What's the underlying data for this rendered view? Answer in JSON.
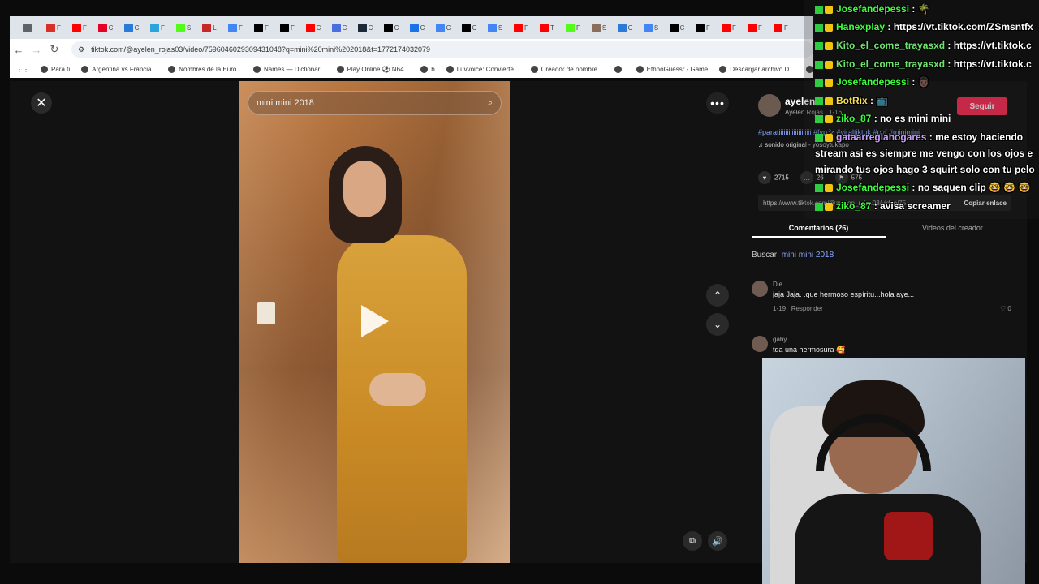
{
  "browser": {
    "tabs": [
      {
        "icon": "down-chevron-icon",
        "color": "#5f6368",
        "ch": ""
      },
      {
        "icon": "gmail-icon",
        "color": "#d93025",
        "ch": "F"
      },
      {
        "icon": "youtube-icon",
        "color": "#ff0000",
        "ch": "F"
      },
      {
        "icon": "pinterest-icon",
        "color": "#e60023",
        "ch": "C"
      },
      {
        "icon": "gif-icon",
        "color": "#2a7bd8",
        "ch": "C"
      },
      {
        "icon": "telegram-icon",
        "color": "#2aa3df",
        "ch": "F"
      },
      {
        "icon": "kick-icon",
        "color": "#53fc18",
        "ch": "S"
      },
      {
        "icon": "bookmark-red-icon",
        "color": "#c62828",
        "ch": "L"
      },
      {
        "icon": "google-icon",
        "color": "#4285f4",
        "ch": "F"
      },
      {
        "icon": "tiktok-icon",
        "color": "#000000",
        "ch": "F"
      },
      {
        "icon": "tiktok-icon",
        "color": "#000000",
        "ch": "F"
      },
      {
        "icon": "youtube-icon",
        "color": "#ff0000",
        "ch": "C"
      },
      {
        "icon": "docs-icon",
        "color": "#4a6ee0",
        "ch": "C"
      },
      {
        "icon": "steam-icon",
        "color": "#1b2838",
        "ch": "C"
      },
      {
        "icon": "tiktok-icon",
        "color": "#000000",
        "ch": "C"
      },
      {
        "icon": "download-icon",
        "color": "#1a73e8",
        "ch": "C"
      },
      {
        "icon": "google-icon",
        "color": "#4285f4",
        "ch": "C"
      },
      {
        "icon": "tiktok-icon",
        "color": "#000000",
        "ch": "C"
      },
      {
        "icon": "google-icon",
        "color": "#4285f4",
        "ch": "S"
      },
      {
        "icon": "youtube-icon",
        "color": "#ff0000",
        "ch": "F"
      },
      {
        "icon": "youtube-icon",
        "color": "#ff0000",
        "ch": "T"
      },
      {
        "icon": "kick-icon",
        "color": "#53fc18",
        "ch": "F"
      },
      {
        "icon": "image-icon",
        "color": "#8a6d5a",
        "ch": "S"
      },
      {
        "icon": "gif-icon",
        "color": "#2a7bd8",
        "ch": "C"
      },
      {
        "icon": "google-icon",
        "color": "#4285f4",
        "ch": "S"
      },
      {
        "icon": "tiktok-icon",
        "color": "#000000",
        "ch": "C"
      },
      {
        "icon": "tiktok-icon",
        "color": "#000000",
        "ch": "F"
      },
      {
        "icon": "youtube-icon",
        "color": "#ff0000",
        "ch": "F"
      },
      {
        "icon": "youtube-icon",
        "color": "#ff0000",
        "ch": "F"
      },
      {
        "icon": "youtube-icon",
        "color": "#ff0000",
        "ch": "F"
      }
    ],
    "url": "tiktok.com/@ayelen_rojas03/video/7596046029309431048?q=mini%20mini%202018&t=1772174032079",
    "bookmarks": [
      "Para ti",
      "Argentina vs Francia...",
      "Nombres de la Euro...",
      "Names — Dictionar...",
      "Play Online ⚽ N64...",
      "b",
      "Luvvoice: Convierte...",
      "Creador de nombre...",
      "",
      "EthnoGuessr - Game",
      "Descargar archivo D...",
      "(FREE FOR PROFIT)..."
    ]
  },
  "video": {
    "search_text": "mini mini 2018",
    "close_glyph": "✕",
    "more_glyph": "•••",
    "up_glyph": "⌃",
    "down_glyph": "⌄",
    "volume_glyph": "🔊",
    "pip_glyph": "⧉"
  },
  "panel": {
    "username": "ayelen",
    "subtitle": "Ayelen Rojas · 1-16",
    "follow_label": "Seguir",
    "hashtags": "#paratiiiiiiiiiiiiiiiiiiii #fypシ #viraltiktok #pyf #minimini",
    "music": "♫  sonido original - yosoytukapo",
    "stats": {
      "likes": "2715",
      "comments": "26",
      "saves": "575"
    },
    "link_text": "https://www.tiktok.com/@ayelen_rojas03/video/75...",
    "copy_link_label": "Copiar enlace",
    "tabs": [
      "Comentarios (26)",
      "Videos del creador"
    ],
    "search_prefix": "Buscar: ",
    "search_query": "mini mini 2018",
    "comments": [
      {
        "name": "Die",
        "text": "jaja Jaja. .que hermoso espíritu...hola aye...",
        "date": "1-19",
        "reply": "Responder",
        "likes": "♡ 0"
      },
      {
        "name": "gaby",
        "text": "tda una hermosura 🥰",
        "date": "",
        "reply": "",
        "likes": ""
      }
    ]
  },
  "chat": [
    {
      "user": "Josefandepessi",
      "color": "#3cff3c",
      "msg": ": 🌴"
    },
    {
      "user": "Hanexplay",
      "color": "#3cff3c",
      "msg": ": https://vt.tiktok.com/ZSmsntfx"
    },
    {
      "user": "Kito_el_come_trayasxd",
      "color": "#6fe36f",
      "msg": ": https://vt.tiktok.c"
    },
    {
      "user": "Kito_el_come_trayasxd",
      "color": "#6fe36f",
      "msg": ": https://vt.tiktok.c"
    },
    {
      "user": "Josefandepessi",
      "color": "#3cff3c",
      "msg": ": 👨🏿"
    },
    {
      "user": "BotRix",
      "color": "#f4e04d",
      "msg": ": 📺"
    },
    {
      "user": "ziko_87",
      "color": "#3cff3c",
      "msg": ": no es mini mini"
    },
    {
      "user": "gataarreglahogares",
      "color": "#c99bff",
      "msg": ": me estoy haciendo"
    },
    {
      "user": "",
      "color": "#ffffff",
      "msg": "stream asi es siempre me vengo con los ojos e"
    },
    {
      "user": "",
      "color": "#ffffff",
      "msg": "mirando tus ojos hago 3 squirt solo con tu pelo"
    },
    {
      "user": "Josefandepessi",
      "color": "#3cff3c",
      "msg": ": no saquen clip 🤓 🤓 🤓"
    },
    {
      "user": "ziko_87",
      "color": "#3cff3c",
      "msg": ": avisa screamer"
    }
  ]
}
